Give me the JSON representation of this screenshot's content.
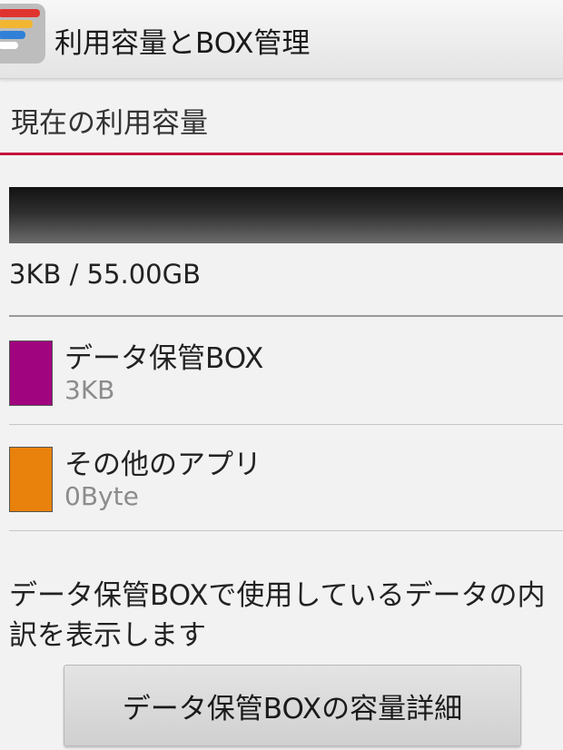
{
  "app": {
    "title": "利用容量とBOX管理",
    "icon": "storage-app-icon"
  },
  "usage": {
    "section_title": "現在の利用容量",
    "used_label": "3KB / 55.00GB",
    "used_fraction": 0.0,
    "accent_color": "#c3143c"
  },
  "legend": [
    {
      "name": "データ保管BOX",
      "size": "3KB",
      "color": "#a0057f"
    },
    {
      "name": "その他のアプリ",
      "size": "0Byte",
      "color": "#e8820c"
    }
  ],
  "description": "データ保管BOXで使用しているデータの内訳を表示します",
  "detail_button_label": "データ保管BOXの容量詳細"
}
